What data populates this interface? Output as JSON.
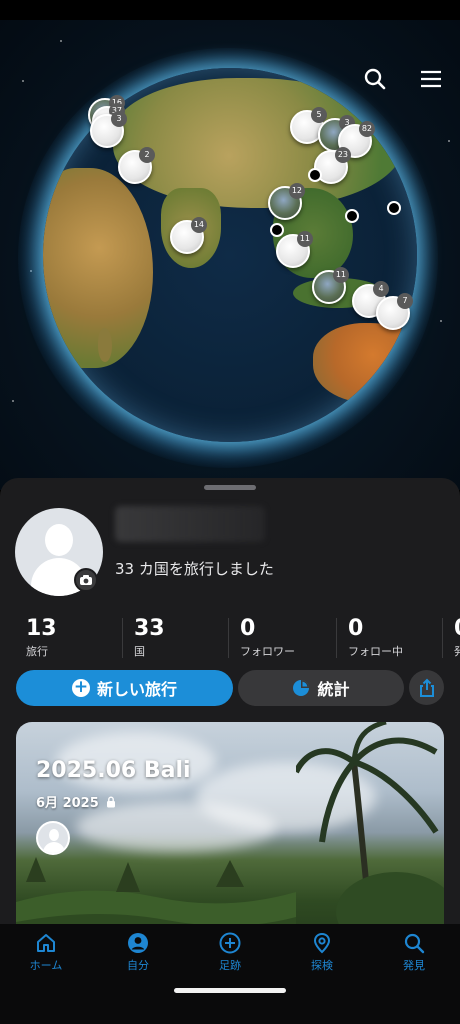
{
  "header": {
    "search_icon": "search-icon",
    "menu_icon": "hamburger-menu-icon"
  },
  "globe": {
    "clusters": [
      {
        "count": "16"
      },
      {
        "count": "37"
      },
      {
        "count": "3"
      },
      {
        "count": "2"
      },
      {
        "count": "14"
      },
      {
        "count": "5"
      },
      {
        "count": "3"
      },
      {
        "count": "82"
      },
      {
        "count": "23"
      },
      {
        "count": "12"
      },
      {
        "count": "11"
      },
      {
        "count": "11"
      },
      {
        "count": "4"
      },
      {
        "count": "7"
      }
    ]
  },
  "profile": {
    "caption": "33 カ国を旅行しました",
    "stats": [
      {
        "value": "13",
        "label": "旅行"
      },
      {
        "value": "33",
        "label": "国"
      },
      {
        "value": "0",
        "label": "フォロワー"
      },
      {
        "value": "0",
        "label": "フォロー中"
      },
      {
        "value": "0",
        "label": "発"
      }
    ]
  },
  "actions": {
    "new_trip": "新しい旅行",
    "stats": "統計",
    "share_icon": "share-icon"
  },
  "trip": {
    "title": "2025.06 Bali",
    "date": "6月 2025"
  },
  "tabs": [
    {
      "label": "ホーム",
      "icon": "home-icon"
    },
    {
      "label": "自分",
      "icon": "profile-icon"
    },
    {
      "label": "足跡",
      "icon": "add-circle-icon"
    },
    {
      "label": "探検",
      "icon": "location-pin-icon"
    },
    {
      "label": "発見",
      "icon": "search-icon"
    }
  ],
  "colors": {
    "accent": "#1C8ED8",
    "sheet_bg": "#1C1C1E",
    "button_secondary": "#38383A"
  }
}
